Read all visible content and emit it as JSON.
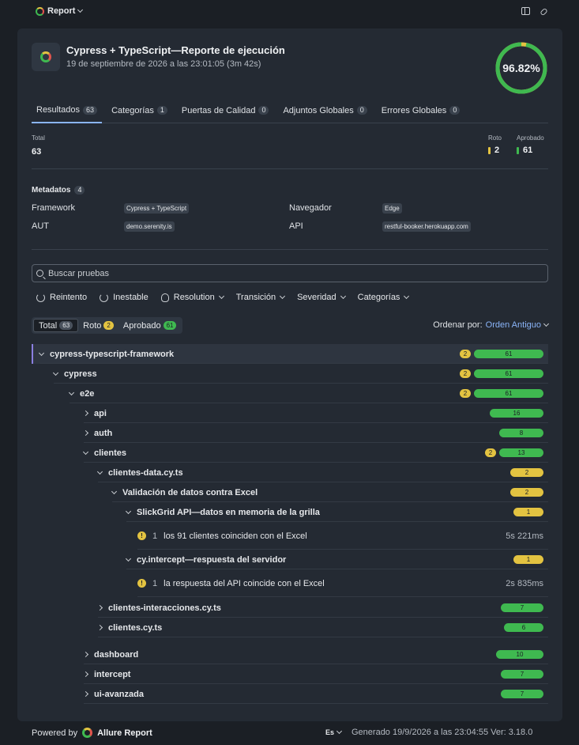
{
  "topbar": {
    "project_label": "Report"
  },
  "header": {
    "title": "Cypress + TypeScript—Reporte de ejecución",
    "subtitle": "19 de septiembre de 2026 a las 23:01:05 (3m 42s)",
    "success_rate": "96.82%",
    "success_fraction": 0.9682
  },
  "tabs": [
    {
      "label": "Resultados",
      "count": "63"
    },
    {
      "label": "Categorías",
      "count": "1"
    },
    {
      "label": "Puertas de Calidad",
      "count": "0"
    },
    {
      "label": "Adjuntos Globales",
      "count": "0"
    },
    {
      "label": "Errores Globales",
      "count": "0"
    }
  ],
  "stats": {
    "total_label": "Total",
    "total_value": "63",
    "broken_label": "Roto",
    "broken_value": "2",
    "passed_label": "Aprobado",
    "passed_value": "61"
  },
  "metadata": {
    "heading": "Metadatos",
    "count": "4",
    "items": [
      {
        "key": "Framework",
        "value": "Cypress + TypeScript"
      },
      {
        "key": "Navegador",
        "value": "Edge"
      },
      {
        "key": "AUT",
        "value": "demo.serenity.is"
      },
      {
        "key": "API",
        "value": "restful-booker.herokuapp.com"
      }
    ]
  },
  "search": {
    "placeholder": "Buscar pruebas"
  },
  "filters": [
    "Reintento",
    "Inestable",
    "Resolution",
    "Transición",
    "Severidad",
    "Categorías"
  ],
  "status_filter": [
    {
      "label": "Total",
      "count": "63"
    },
    {
      "label": "Roto",
      "count": "2"
    },
    {
      "label": "Aprobado",
      "count": "61"
    }
  ],
  "sort": {
    "label": "Ordenar por:",
    "value": "Orden Antiguo"
  },
  "tree": [
    {
      "label": "cypress-typescript-framework",
      "broken": "2",
      "passed": "61"
    },
    {
      "label": "cypress",
      "broken": "2",
      "passed": "61"
    },
    {
      "label": "e2e",
      "broken": "2",
      "passed": "61"
    },
    {
      "label": "api",
      "passed": "16"
    },
    {
      "label": "auth",
      "passed": "8"
    },
    {
      "label": "clientes",
      "broken": "2",
      "passed": "13"
    },
    {
      "label": "clientes-data.cy.ts",
      "broken": "2"
    },
    {
      "label": "Validación de datos contra Excel",
      "broken": "2"
    },
    {
      "label": "SlickGrid API—datos en memoria de la grilla",
      "broken": "1"
    },
    {
      "num": "1",
      "label": "los 91 clientes coinciden con el Excel",
      "duration": "5s 221ms"
    },
    {
      "label": "cy.intercept—respuesta del servidor",
      "broken": "1"
    },
    {
      "num": "1",
      "label": "la respuesta del API coincide con el Excel",
      "duration": "2s 835ms"
    },
    {
      "label": "clientes-interacciones.cy.ts",
      "passed": "7"
    },
    {
      "label": "clientes.cy.ts",
      "passed": "6"
    },
    {
      "label": "dashboard",
      "passed": "10"
    },
    {
      "label": "intercept",
      "passed": "7"
    },
    {
      "label": "ui-avanzada",
      "passed": "7"
    }
  ],
  "footer": {
    "powered": "Powered by",
    "brand": "Allure Report",
    "lang": "Es",
    "generated": "Generado 19/9/2026 a las 23:04:55 Ver: 3.18.0"
  },
  "colors": {
    "passed": "#3fb950",
    "broken": "#e3c341",
    "accent": "#8ab4f8"
  }
}
